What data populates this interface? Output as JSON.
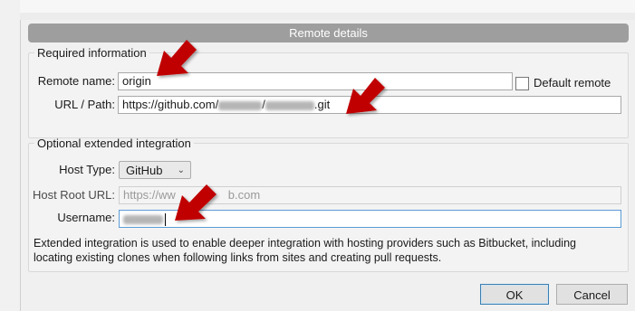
{
  "dialog": {
    "title": "Remote details"
  },
  "required": {
    "legend": "Required information",
    "remote_name_label": "Remote name:",
    "remote_name_value": "origin",
    "default_remote_label": "Default remote",
    "default_remote_checked": false,
    "url_label": "URL / Path:",
    "url_prefix": "https://github.com/",
    "url_sep": "/",
    "url_suffix": ".git"
  },
  "optional": {
    "legend": "Optional extended integration",
    "host_type_label": "Host Type:",
    "host_type_value": "GitHub",
    "host_root_label": "Host Root URL:",
    "host_root_start": "https://ww",
    "host_root_end": "b.com",
    "username_label": "Username:",
    "note": "Extended integration is used to enable deeper integration with hosting providers such as Bitbucket, including locating existing clones when following links from sites and creating pull requests."
  },
  "buttons": {
    "ok": "OK",
    "cancel": "Cancel"
  },
  "colors": {
    "annotation_arrow": "#c00000",
    "titlebar": "#9e9e9e",
    "focus_border": "#5b9bd5"
  },
  "icons": {
    "dropdown": "chevron-down-icon",
    "annotation": "arrow-icon"
  }
}
